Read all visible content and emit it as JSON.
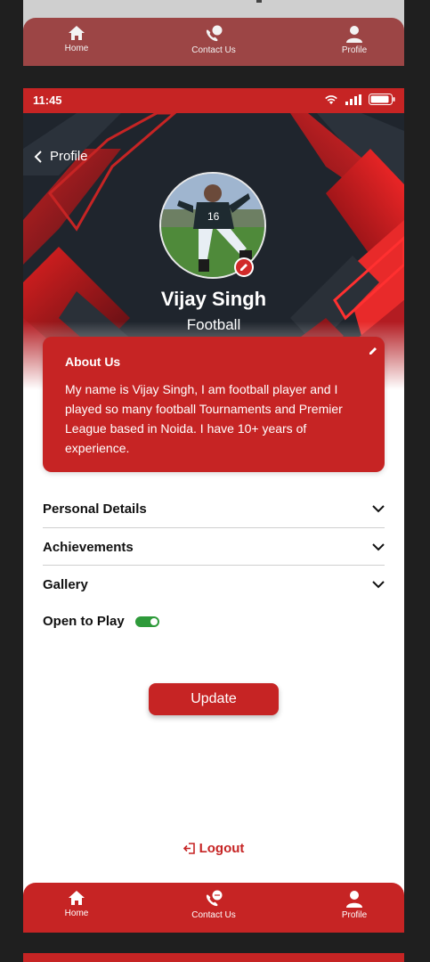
{
  "status_bar": {
    "time": "11:45"
  },
  "header": {
    "back_label": "Profile"
  },
  "profile": {
    "name": "Vijay Singh",
    "sport": "Football"
  },
  "about": {
    "title": "About Us",
    "text": "My name is Vijay Singh, I am football player and I played so many football Tournaments and Premier League based in Noida. I have 10+ years of experience."
  },
  "sections": [
    {
      "label": "Personal Details"
    },
    {
      "label": "Achievements"
    },
    {
      "label": "Gallery"
    }
  ],
  "open_to_play": {
    "label": "Open to Play",
    "enabled": true
  },
  "update_label": "Update",
  "logout_label": "Logout",
  "nav": [
    {
      "label": "Home",
      "icon": "home-icon"
    },
    {
      "label": "Contact Us",
      "icon": "contact-icon"
    },
    {
      "label": "Profile",
      "icon": "profile-icon"
    }
  ],
  "colors": {
    "primary": "#c62424",
    "hero_bg": "#1f252d",
    "toggle_on": "#2e9a3a"
  }
}
